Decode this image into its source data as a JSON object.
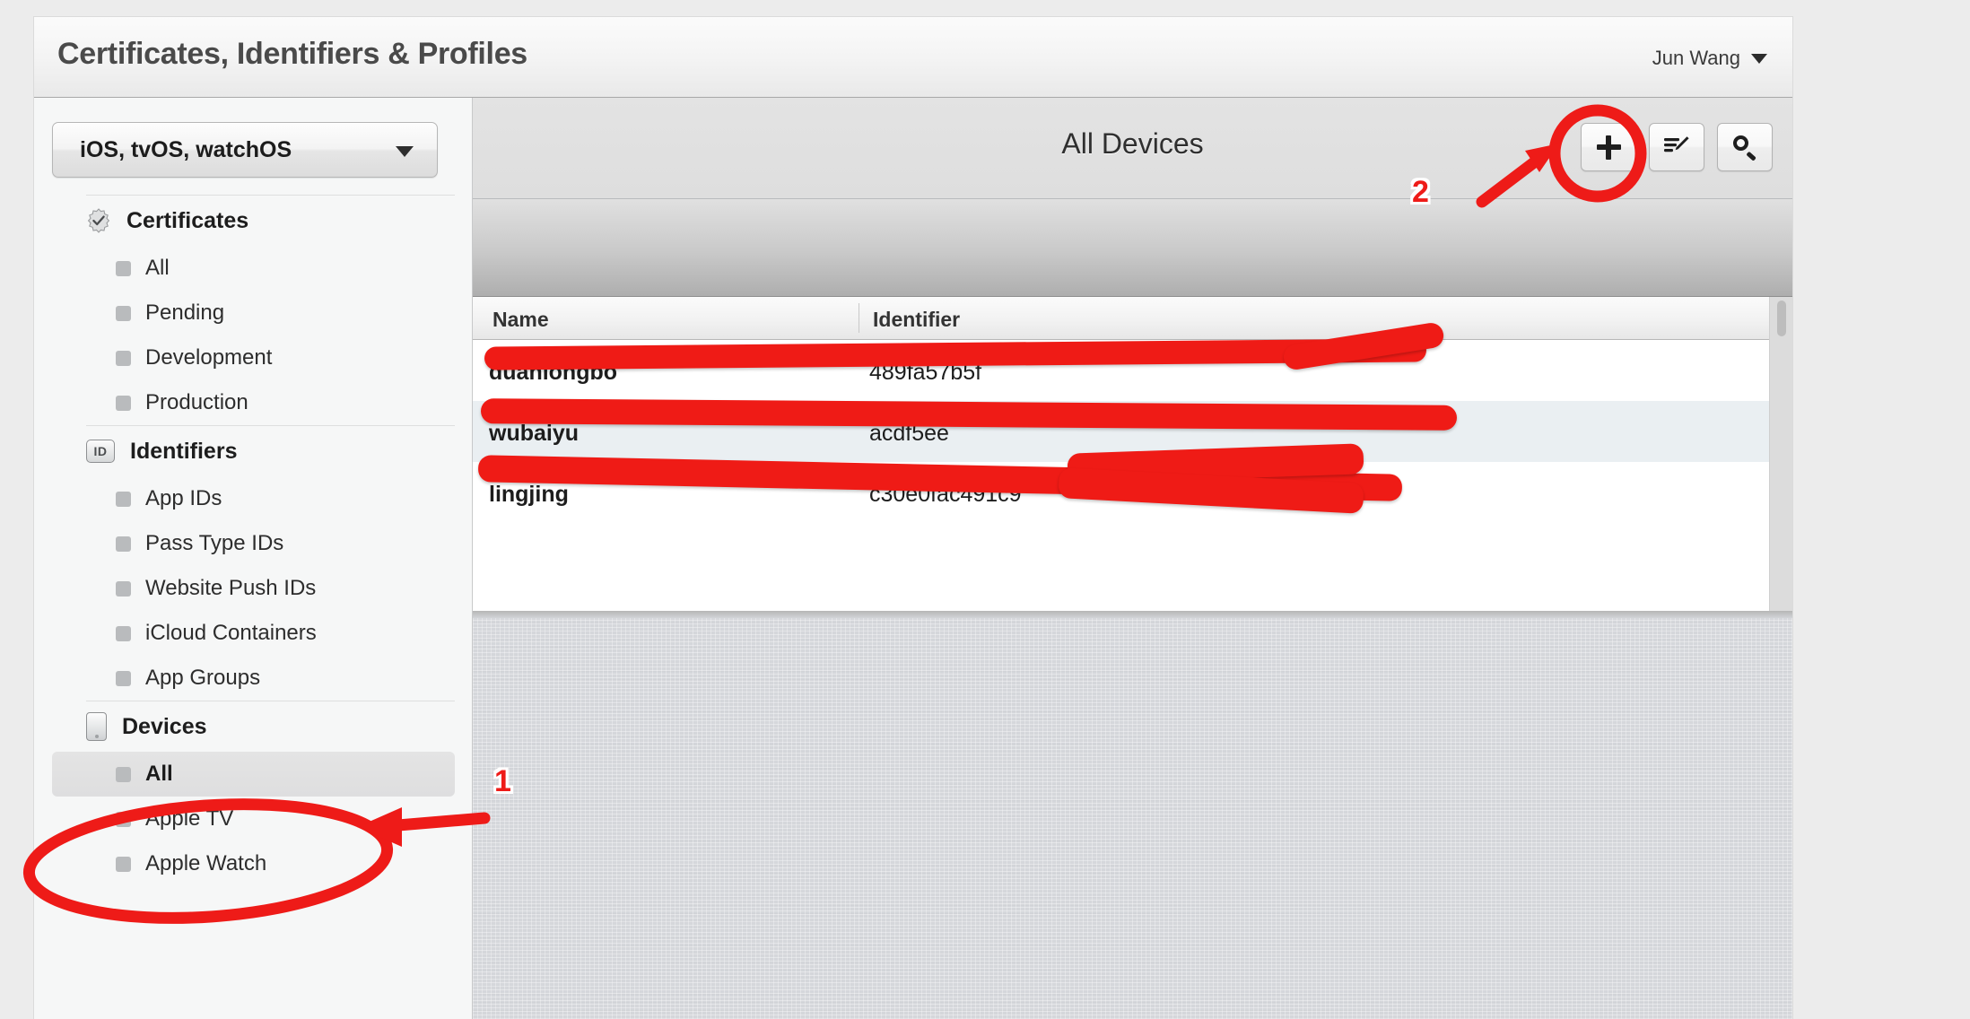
{
  "header": {
    "title": "Certificates, Identifiers & Profiles",
    "account_name": "Jun Wang"
  },
  "sidebar": {
    "platform_selector": {
      "value": "iOS, tvOS, watchOS"
    },
    "groups": [
      {
        "label": "Certificates",
        "icon": "seal-check-icon",
        "items": [
          {
            "label": "All",
            "selected": false
          },
          {
            "label": "Pending",
            "selected": false
          },
          {
            "label": "Development",
            "selected": false
          },
          {
            "label": "Production",
            "selected": false
          }
        ]
      },
      {
        "label": "Identifiers",
        "icon": "id-badge-icon",
        "icon_text": "ID",
        "items": [
          {
            "label": "App IDs",
            "selected": false
          },
          {
            "label": "Pass Type IDs",
            "selected": false
          },
          {
            "label": "Website Push IDs",
            "selected": false
          },
          {
            "label": "iCloud Containers",
            "selected": false
          },
          {
            "label": "App Groups",
            "selected": false
          }
        ]
      },
      {
        "label": "Devices",
        "icon": "device-phone-icon",
        "items": [
          {
            "label": "All",
            "selected": true
          },
          {
            "label": "Apple TV",
            "selected": false
          },
          {
            "label": "Apple Watch",
            "selected": false
          }
        ]
      }
    ]
  },
  "content": {
    "title": "All Devices",
    "toolbar": {
      "add_button": "add-device-button",
      "edit_button": "edit-devices-button",
      "search_button": "search-button"
    },
    "table": {
      "columns": [
        "Name",
        "Identifier"
      ],
      "rows": [
        {
          "name": "duanlongbo",
          "identifier": "489fa57b5f"
        },
        {
          "name": "wubaiyu",
          "identifier": "acdf5ee"
        },
        {
          "name": "lingjing",
          "identifier": "c30e0fac491c9"
        }
      ]
    }
  },
  "annotations": {
    "step_one": "1",
    "step_two": "2",
    "accent_color": "#ee1b18"
  }
}
